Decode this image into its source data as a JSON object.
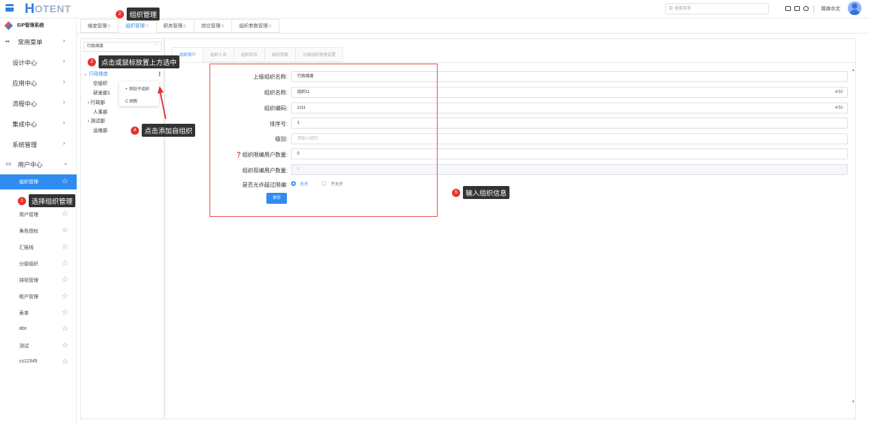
{
  "topbar": {
    "logo_h": "H",
    "logo_rest": "OTENT",
    "search_placeholder": "搜索菜单",
    "lang": "简体中文",
    "icons": [
      "monitor-icon",
      "fullscreen-icon",
      "settings-icon"
    ]
  },
  "sidebar": {
    "system_title": "EIP管理系统",
    "sections": [
      {
        "label": "常用菜单"
      },
      {
        "label": "设计中心"
      },
      {
        "label": "应用中心"
      },
      {
        "label": "流程中心"
      },
      {
        "label": "集成中心"
      },
      {
        "label": "系统管理"
      },
      {
        "label": "用户中心"
      }
    ],
    "sub_items": [
      {
        "label": "组织管理"
      },
      {
        "label": "用户管理"
      },
      {
        "label": "角色授权"
      },
      {
        "label": "汇报线"
      },
      {
        "label": "分级组织"
      },
      {
        "label": "排班管理"
      },
      {
        "label": "租户管理"
      },
      {
        "label": "表单"
      },
      {
        "label": "abc"
      },
      {
        "label": "测试"
      },
      {
        "label": "cs12345"
      }
    ]
  },
  "tabs": [
    "维度管理☆",
    "组织管理☆",
    "职务管理☆",
    "岗位管理☆",
    "组织参数管理☆"
  ],
  "tree": {
    "dimension": "行政维度",
    "root": "行政维度",
    "nodes": [
      "空组织",
      "研发部1",
      "行政部",
      "人事部",
      "测试部",
      "运维部"
    ]
  },
  "context_menu": {
    "add": "+ 添加子组织",
    "refresh": "C 刷新"
  },
  "inner_tabs": [
    "组织简介",
    "组织人员",
    "组织岗位",
    "组织参数",
    "分级组织管理设置"
  ],
  "form": {
    "parent_label": "上级组织名称:",
    "parent_value": "行政维度",
    "name_label": "组织名称:",
    "name_value": "组织11",
    "name_count": "4/50",
    "code_label": "组织编码:",
    "code_value": "zz11",
    "code_count": "4/50",
    "order_label": "排序号:",
    "order_value": "1",
    "level_label": "级别:",
    "level_placeholder": "请输入级别",
    "limit_label": "❓组织限编用户数量:",
    "limit_value": "0",
    "current_label": "组织现编用户数量:",
    "current_value": "0",
    "allow_label": "是否允许超过限编:",
    "allow_yes": "允许",
    "allow_no": "不允许",
    "save": "保存"
  },
  "annotations": {
    "a1_num": "1",
    "a1_text": "选择组织管理",
    "a2_num": "2",
    "a2_text": "组织管理",
    "a3_num": "3",
    "a3_text": "点击或鼠标放置上方选中",
    "a4_num": "4",
    "a4_text": "点击添加自组织",
    "a5_num": "5",
    "a5_text": "输入组织信息"
  }
}
